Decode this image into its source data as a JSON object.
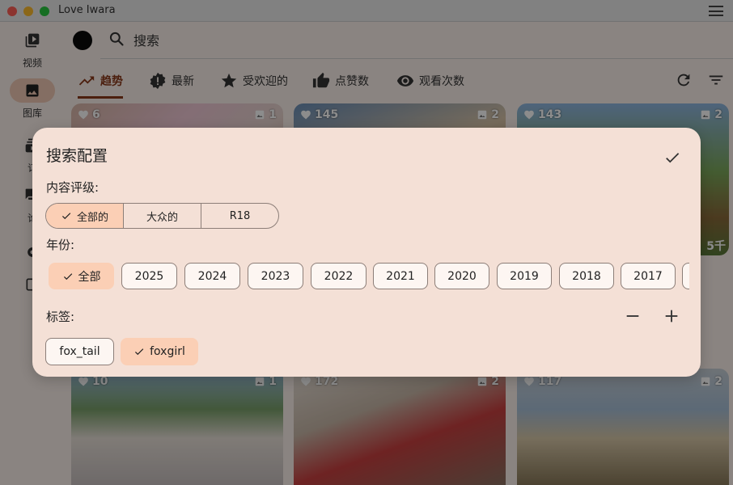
{
  "window": {
    "title": "Love Iwara"
  },
  "rail": {
    "items": [
      {
        "label": "视频",
        "icon": "video-library-icon"
      },
      {
        "label": "图库",
        "icon": "image-icon"
      },
      {
        "label": "订",
        "icon": "subscriptions-icon"
      },
      {
        "label": "论",
        "icon": "forum-icon"
      }
    ]
  },
  "search": {
    "placeholder": "搜索"
  },
  "tabs": [
    {
      "label": "趋势",
      "icon": "trending-up-icon",
      "active": true
    },
    {
      "label": "最新",
      "icon": "new-badge-icon",
      "active": false
    },
    {
      "label": "受欢迎的",
      "icon": "star-icon",
      "active": false
    },
    {
      "label": "点赞数",
      "icon": "thumb-up-icon",
      "active": false
    },
    {
      "label": "观看次数",
      "icon": "eye-icon",
      "active": false
    }
  ],
  "cards": [
    {
      "likes": "6",
      "images": "1"
    },
    {
      "likes": "145",
      "images": "2"
    },
    {
      "likes": "143",
      "images": "2",
      "extra": "5千"
    },
    {
      "likes": "10",
      "images": "1"
    },
    {
      "likes": "172",
      "images": "2"
    },
    {
      "likes": "117",
      "images": "2"
    }
  ],
  "dialog": {
    "title": "搜索配置",
    "rating_label": "内容评级:",
    "rating_options": [
      {
        "label": "全部的",
        "selected": true
      },
      {
        "label": "大众的",
        "selected": false
      },
      {
        "label": "R18",
        "selected": false
      }
    ],
    "year_label": "年份:",
    "year_options": [
      {
        "label": "全部",
        "selected": true
      },
      {
        "label": "2025",
        "selected": false
      },
      {
        "label": "2024",
        "selected": false
      },
      {
        "label": "2023",
        "selected": false
      },
      {
        "label": "2022",
        "selected": false
      },
      {
        "label": "2021",
        "selected": false
      },
      {
        "label": "2020",
        "selected": false
      },
      {
        "label": "2019",
        "selected": false
      },
      {
        "label": "2018",
        "selected": false
      },
      {
        "label": "2017",
        "selected": false
      }
    ],
    "tag_label": "标签:",
    "tags": [
      {
        "label": "fox_tail",
        "selected": false
      },
      {
        "label": "foxgirl",
        "selected": true
      }
    ]
  },
  "colors": {
    "accent": "#8a3a1a",
    "selected_chip": "#fbcfb5",
    "dialog_bg": "#f4e0d6",
    "app_bg": "#fbf1ec"
  }
}
